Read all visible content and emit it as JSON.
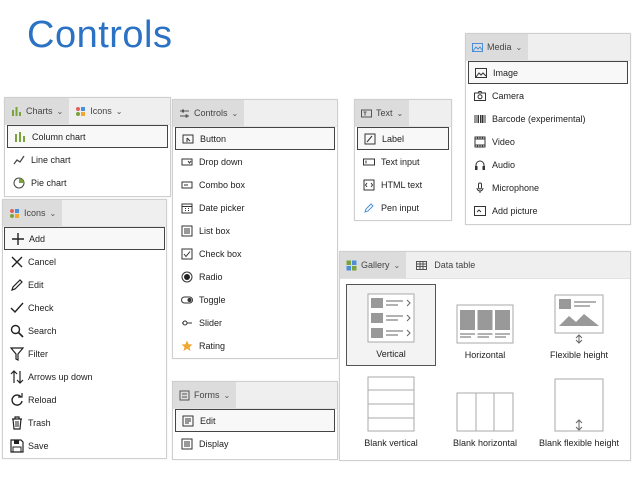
{
  "title": "Controls",
  "charts_panel": {
    "tabs": [
      "Charts",
      "Icons"
    ],
    "items": [
      "Column chart",
      "Line chart",
      "Pie chart"
    ]
  },
  "icons_panel": {
    "tab": "Icons",
    "items": [
      "Add",
      "Cancel",
      "Edit",
      "Check",
      "Search",
      "Filter",
      "Arrows up down",
      "Reload",
      "Trash",
      "Save"
    ]
  },
  "controls_panel": {
    "tab": "Controls",
    "items": [
      "Button",
      "Drop down",
      "Combo box",
      "Date picker",
      "List box",
      "Check box",
      "Radio",
      "Toggle",
      "Slider",
      "Rating"
    ]
  },
  "forms_panel": {
    "tab": "Forms",
    "items": [
      "Edit",
      "Display"
    ]
  },
  "text_panel": {
    "tab": "Text",
    "items": [
      "Label",
      "Text input",
      "HTML text",
      "Pen input"
    ]
  },
  "media_panel": {
    "tab": "Media",
    "items": [
      "Image",
      "Camera",
      "Barcode (experimental)",
      "Video",
      "Audio",
      "Microphone",
      "Add picture"
    ]
  },
  "gallery_panel": {
    "tabs": [
      "Gallery",
      "Data table"
    ],
    "cells": [
      "Vertical",
      "Horizontal",
      "Flexible height",
      "Blank vertical",
      "Blank horizontal",
      "Blank flexible height"
    ]
  },
  "colors": {
    "accent": "#2b72c4",
    "star": "#f0a830",
    "chart_green": "#7aa33b"
  }
}
